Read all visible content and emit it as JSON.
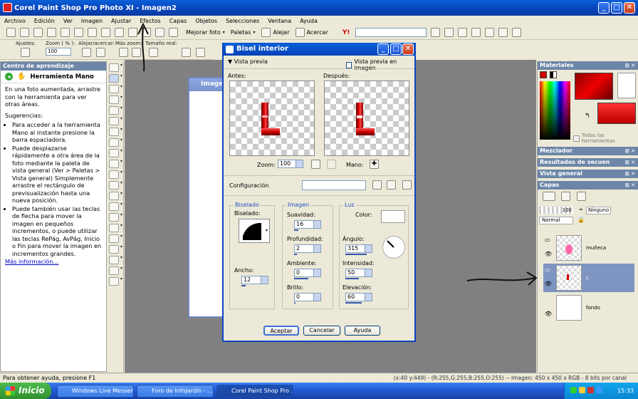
{
  "window": {
    "title": "Corel Paint Shop Pro Photo XI - Imagen2"
  },
  "menu": [
    "Archivo",
    "Edición",
    "Ver",
    "Imagen",
    "Ajustar",
    "Efectos",
    "Capas",
    "Objetos",
    "Selecciones",
    "Ventana",
    "Ayuda"
  ],
  "toolbar": {
    "enhance_label": "Mejorar foto",
    "palettes_label": "Paletas",
    "zoom_out_label": "Alejar",
    "zoom_in_label": "Acercar"
  },
  "options": {
    "ajustes_label": "Ajustes:",
    "zoom_label": "Zoom ( % ):",
    "zoom_value": "100",
    "alejar_label": "Alejar/acercar:",
    "mas_zoom_label": "Más zoom:",
    "tamano_label": "Tamaño real:"
  },
  "learning": {
    "header": "Centro de aprendizaje",
    "title": "Herramienta Mano",
    "intro": "En una foto aumentada, arrastre con la herramienta para ver otras áreas.",
    "suggestions_label": "Sugerencias:",
    "tips": [
      "Para acceder a la herramienta Mano al instante presione la barra espaciadora.",
      "Puede desplazarse rápidamente a otra área de la foto mediante la paleta de vista general (Ver > Paletas > Vista general) Simplemente arrastre el rectángulo de previsualización hasta una nueva posición.",
      "Puede también usar las teclas de flecha para mover la imagen en pequeños incrementos, o puede utilizar las teclas RePág, AvPág, Inicio o Fin para mover la imagen en incrementos grandes."
    ],
    "more_link": "Más información..."
  },
  "image_window": {
    "title": "Imagen"
  },
  "dialog": {
    "title": "Bisel interior",
    "preview_toggle": "Vista previa",
    "preview_in_image": "Vista previa en imagen",
    "before_label": "Antes:",
    "after_label": "Después:",
    "zoom_label": "Zoom:",
    "zoom_value": "100",
    "pan_label": "Mano:",
    "config_label": "Configuración",
    "bevel_group": "Biselado",
    "bevel_label": "Biselado:",
    "width_label": "Ancho:",
    "width_value": "12",
    "image_group": "Imagen",
    "smoothness_label": "Suavidad:",
    "smoothness_value": "16",
    "depth_label": "Profundidad:",
    "depth_value": "2",
    "ambient_label": "Ambiente:",
    "ambient_value": "0",
    "shine_label": "Brillo:",
    "shine_value": "0",
    "light_group": "Luz",
    "color_label": "Color:",
    "angle_label": "Ángulo:",
    "angle_value": "315",
    "intensity_label": "Intensidad:",
    "intensity_value": "50",
    "elevation_label": "Elevación:",
    "elevation_value": "60",
    "ok": "Aceptar",
    "cancel": "Cancelar",
    "help": "Ayuda"
  },
  "right_panels": {
    "materials": "Materiales",
    "all_tools": "Todas las herramientas",
    "mixer": "Mezclador",
    "history": "Resultados de secuen",
    "overview": "Vista general",
    "layers": "Capas",
    "opacity": "100",
    "mask": "Ninguno",
    "blend": "Normal",
    "layer_names": [
      "muñeca",
      "L",
      "fondo"
    ]
  },
  "statusbar": {
    "help": "Para obtener ayuda, presione F1",
    "info": "(x:40 y:449) - (R:255,G:255,B:255,O:255) -- Imagen: 450 x 450 x RGB - 8 bits por canal"
  },
  "taskbar": {
    "start": "Inicio",
    "tasks": [
      "Windows Live Messen...",
      "Foro de InfoJardín - ...",
      "Corel Paint Shop Pro ..."
    ],
    "clock": "15:33"
  },
  "colors": {
    "titlebar": "#0743b8",
    "panel_header": "#6d86a8",
    "accent_red": "#cc0000"
  }
}
